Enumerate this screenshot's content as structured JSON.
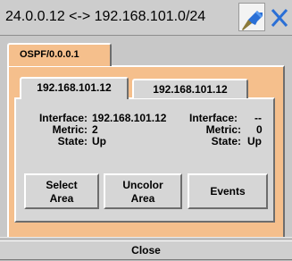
{
  "header": {
    "title": "24.0.0.12 <-> 192.168.101.0/24",
    "pin_icon": "pin-icon",
    "close_icon": "close-icon",
    "accent_blue": "#2a6fd6"
  },
  "outer_tab": {
    "label": "OSPF/0.0.0.1",
    "color": "#f5bf8c"
  },
  "inner_tabs": [
    {
      "label": "192.168.101.12",
      "selected": true
    },
    {
      "label": "192.168.101.12",
      "selected": false
    }
  ],
  "details": {
    "left": {
      "interface_label": "Interface:",
      "interface_value": "192.168.101.12",
      "metric_label": "Metric:",
      "metric_value": "2",
      "state_label": "State:",
      "state_value": "Up"
    },
    "right": {
      "interface_label": "Interface:",
      "interface_value": "--",
      "metric_label": "Metric:",
      "metric_value": "0",
      "state_label": "State:",
      "state_value": "Up"
    }
  },
  "buttons": {
    "select_area": "Select\nArea",
    "uncolor_area": "Uncolor\nArea",
    "events": "Events"
  },
  "footer": {
    "close_label": "Close"
  }
}
